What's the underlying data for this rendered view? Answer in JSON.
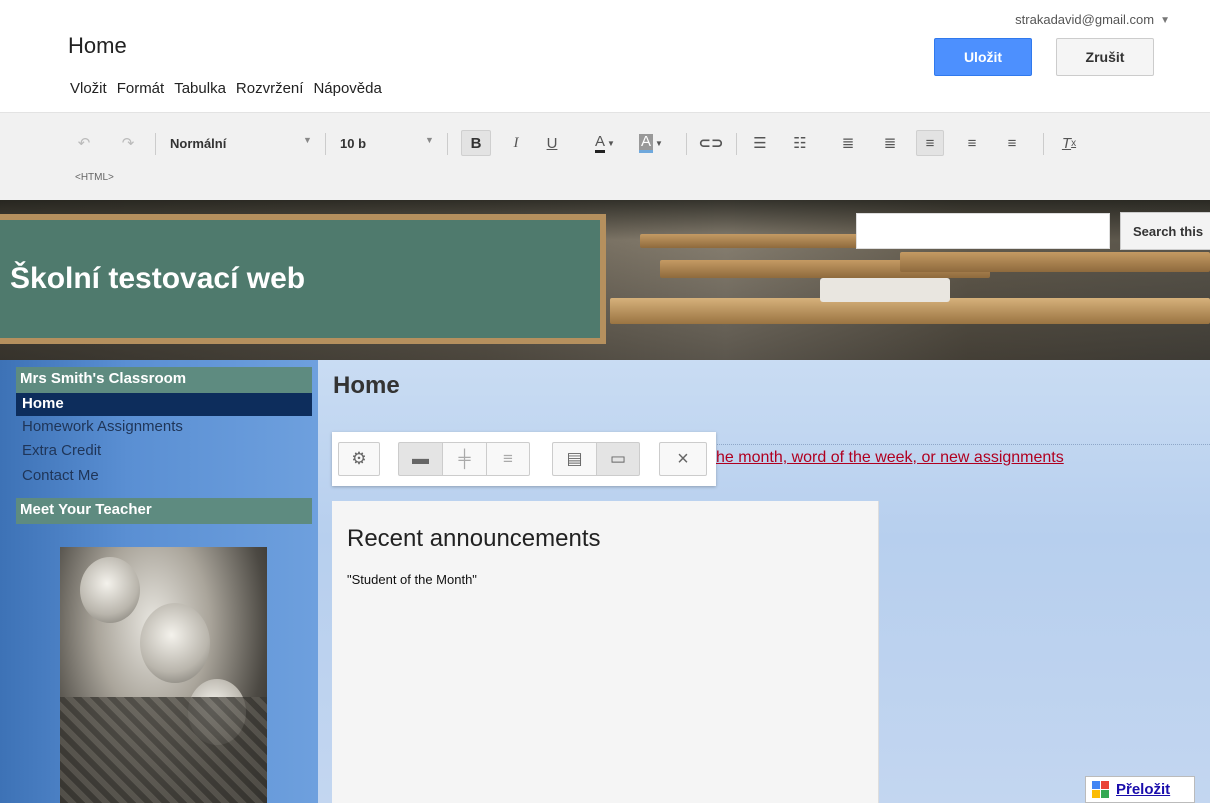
{
  "editor": {
    "page_title": "Home",
    "menu": [
      "Vložit",
      "Formát",
      "Tabulka",
      "Rozvržení",
      "Nápověda"
    ],
    "account": "strakadavid@gmail.com",
    "save_label": "Uložit",
    "cancel_label": "Zrušit"
  },
  "toolbar": {
    "style_select": "Normální",
    "size_select": "10 b",
    "html_label": "<HTML>"
  },
  "site": {
    "title": "Školní testovací web",
    "search_button": "Search this"
  },
  "sidebar": {
    "heading": "Mrs Smith's Classroom",
    "items": [
      "Home",
      "Homework Assignments",
      "Extra Credit",
      "Contact Me"
    ],
    "teacher_heading": "Meet Your Teacher"
  },
  "main": {
    "title": "Home",
    "link_text": "he month, word of the week, or new assignments",
    "announcements_title": "Recent announcements",
    "announcements": [
      "\"Student of the Month\""
    ],
    "translate_label": "Přeložit"
  },
  "colors": {
    "primary_button": "#4d90fe",
    "sidebar_active": "#0d2d5c",
    "sidebar_heading": "#5e8b80",
    "chalkboard": "#4f7a6d",
    "link": "#b00020"
  }
}
